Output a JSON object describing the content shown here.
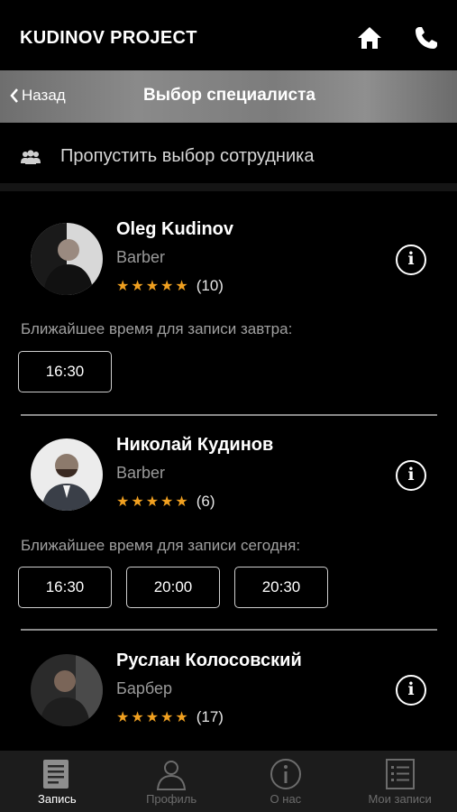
{
  "header": {
    "brand": "KUDINOV PROJECT",
    "home_icon": "home-icon",
    "phone_icon": "phone-icon"
  },
  "nav": {
    "back_label": "Назад",
    "title": "Выбор специалиста"
  },
  "skip": {
    "label": "Пропустить выбор сотрудника",
    "icon": "users-icon"
  },
  "colors": {
    "star": "#f0a020",
    "background": "#000000",
    "tabbar": "#1c1c1c"
  },
  "specialists": [
    {
      "name": "Oleg Kudinov",
      "role": "Barber",
      "stars": "★★★★★",
      "reviews": "(10)",
      "nearest": "Ближайшее время для записи завтра:",
      "slots": [
        "16:30"
      ]
    },
    {
      "name": "Николай Кудинов",
      "role": "Barber",
      "stars": "★★★★★",
      "reviews": "(6)",
      "nearest": "Ближайшее время для записи сегодня:",
      "slots": [
        "16:30",
        "20:00",
        "20:30"
      ]
    },
    {
      "name": "Руслан Колосовский",
      "role": "Барбер",
      "stars": "★★★★★",
      "reviews": "(17)"
    }
  ],
  "tabs": [
    {
      "label": "Запись",
      "icon": "book-icon",
      "active": true
    },
    {
      "label": "Профиль",
      "icon": "profile-icon",
      "active": false
    },
    {
      "label": "О нас",
      "icon": "info-icon",
      "active": false
    },
    {
      "label": "Мои записи",
      "icon": "list-icon",
      "active": false
    }
  ]
}
